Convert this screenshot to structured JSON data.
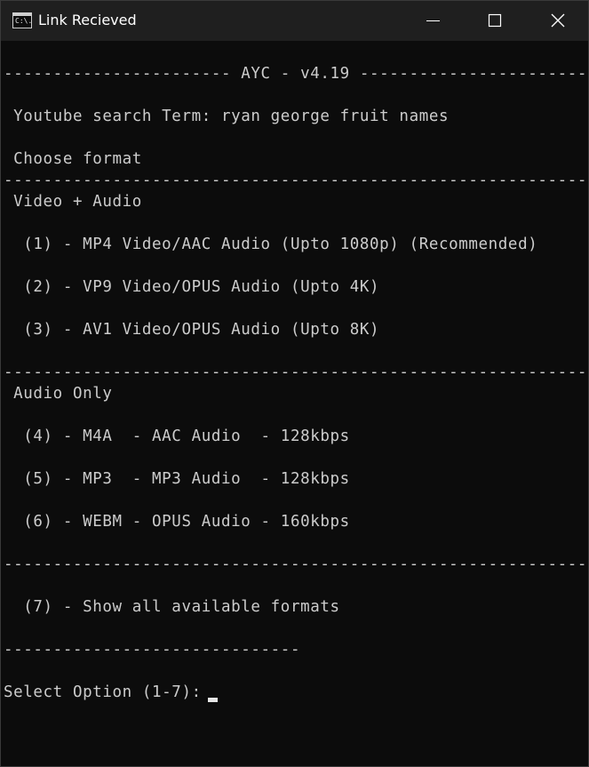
{
  "window": {
    "title": "Link Recieved",
    "icon_label": "C:\\."
  },
  "console": {
    "header_rule": "----------------------- AYC - v4.19 ------------------------------------------",
    "search_line": " Youtube search Term: ryan george fruit names",
    "choose_line": " Choose format",
    "rule_long": "---------------------------------------------------------------------------------------------",
    "video_audio_heading": " Video + Audio",
    "option_1": "  (1) - MP4 Video/AAC Audio (Upto 1080p) (Recommended)",
    "option_2": "  (2) - VP9 Video/OPUS Audio (Upto 4K)",
    "option_3": "  (3) - AV1 Video/OPUS Audio (Upto 8K)",
    "audio_only_heading": " Audio Only",
    "option_4": "  (4) - M4A  - AAC Audio  - 128kbps",
    "option_5": "  (5) - MP3  - MP3 Audio  - 128kbps",
    "option_6": "  (6) - WEBM - OPUS Audio - 160kbps",
    "option_7": "  (7) - Show all available formats",
    "rule_short": "------------------------------",
    "prompt": "Select Option (1-7): "
  },
  "colors": {
    "console_bg": "#0c0c0c",
    "console_text": "#cccccc",
    "titlebar_bg": "#1f1f1f"
  },
  "icons": [
    "console-app-icon",
    "minimize-icon",
    "maximize-icon",
    "close-icon"
  ]
}
